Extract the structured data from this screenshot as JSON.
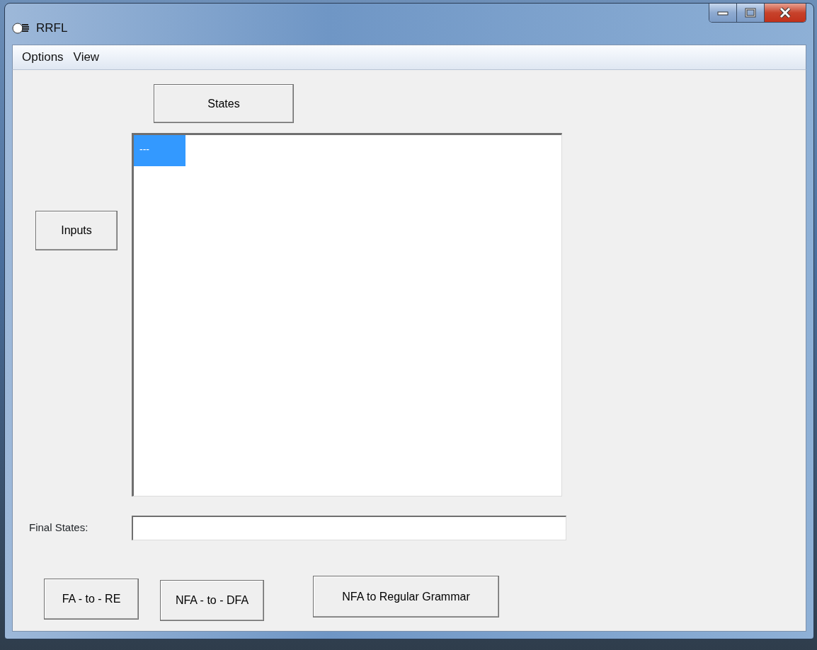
{
  "window": {
    "title": "RRFL"
  },
  "menu": [
    {
      "label": "Options"
    },
    {
      "label": "View"
    }
  ],
  "states_button": "States",
  "inputs_button": "Inputs",
  "list": {
    "items": [
      {
        "text": "---",
        "selected": true
      }
    ]
  },
  "final_states": {
    "label": "Final States:"
  },
  "actions": [
    {
      "label": "FA - to - RE"
    },
    {
      "label": "NFA - to - DFA"
    },
    {
      "label": "NFA to Regular Grammar"
    }
  ]
}
